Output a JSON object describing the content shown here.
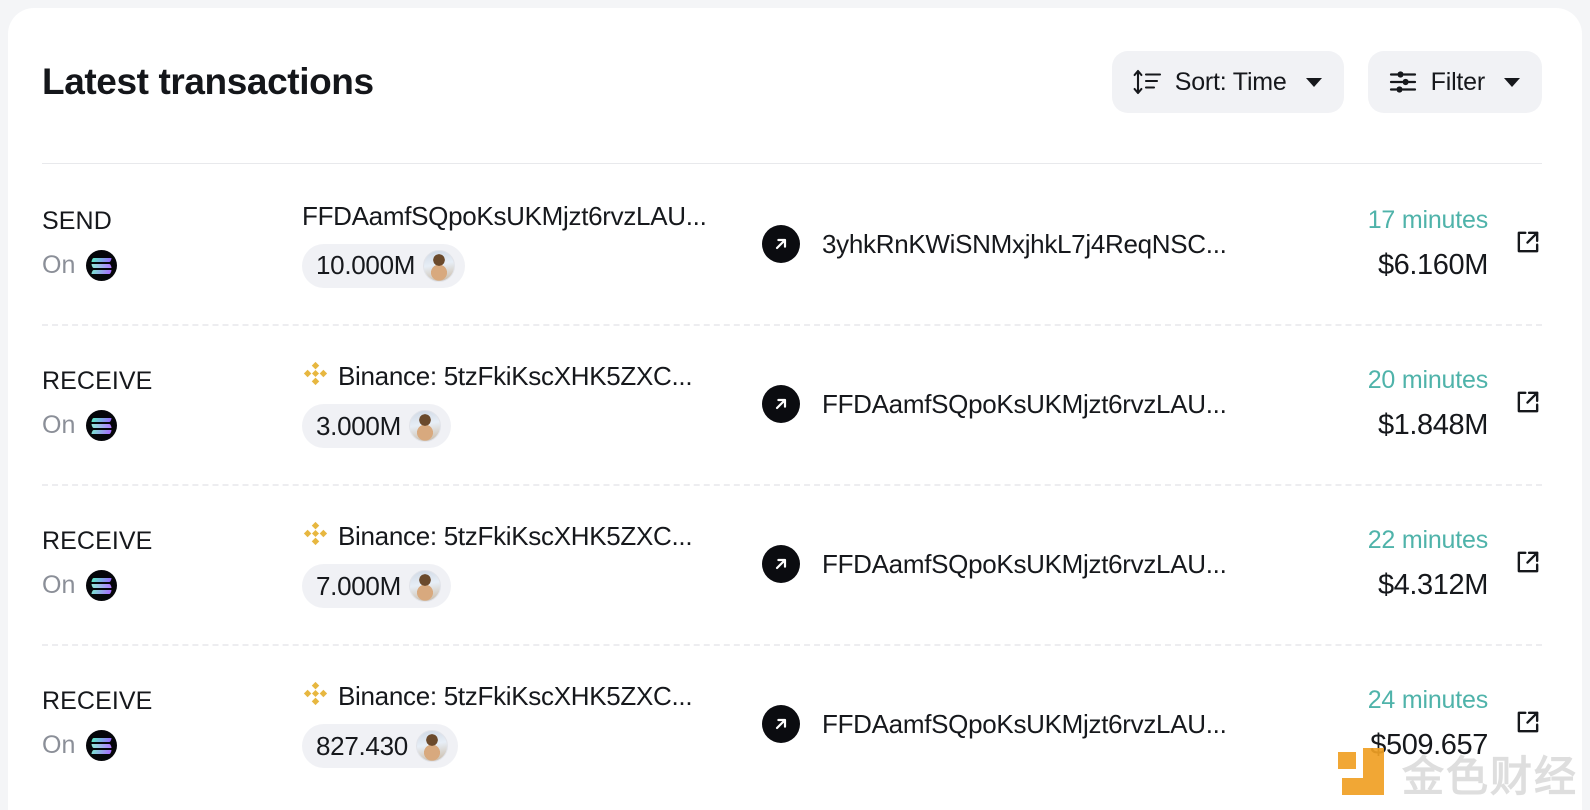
{
  "header": {
    "title": "Latest transactions",
    "sort_button": {
      "label": "Sort: Time",
      "icon": "sort-icon"
    },
    "filter_button": {
      "label": "Filter",
      "icon": "filter-sliders-icon"
    }
  },
  "table": {
    "chain_prefix": "On",
    "chain_name": "Solana",
    "rows": [
      {
        "direction": "SEND",
        "from": "FFDAamfSQpoKsUKMjzt6rvzLAU...",
        "from_has_binance_logo": false,
        "amount": "10.000M",
        "to": "3yhkRnKWiSNMxjhkL7j4ReqNSC...",
        "time": "17 minutes",
        "usd": "$6.160M"
      },
      {
        "direction": "RECEIVE",
        "from": "Binance: 5tzFkiKscXHK5ZXC...",
        "from_has_binance_logo": true,
        "amount": "3.000M",
        "to": "FFDAamfSQpoKsUKMjzt6rvzLAU...",
        "time": "20 minutes",
        "usd": "$1.848M"
      },
      {
        "direction": "RECEIVE",
        "from": "Binance: 5tzFkiKscXHK5ZXC...",
        "from_has_binance_logo": true,
        "amount": "7.000M",
        "to": "FFDAamfSQpoKsUKMjzt6rvzLAU...",
        "time": "22 minutes",
        "usd": "$4.312M"
      },
      {
        "direction": "RECEIVE",
        "from": "Binance: 5tzFkiKscXHK5ZXC...",
        "from_has_binance_logo": true,
        "amount": "827.430",
        "to": "FFDAamfSQpoKsUKMjzt6rvzLAU...",
        "time": "24 minutes",
        "usd": "$509.657"
      }
    ]
  },
  "watermark": {
    "text": "金色财经"
  },
  "colors": {
    "page_background": "#f4f5f7",
    "card_background": "#ffffff",
    "text_primary": "#16181c",
    "text_muted": "#8b8f98",
    "time_accent": "#4fb3aa",
    "pill_background": "#f1f2f5",
    "binance_gold": "#e7b740",
    "watermark_orange": "#f0a024"
  }
}
